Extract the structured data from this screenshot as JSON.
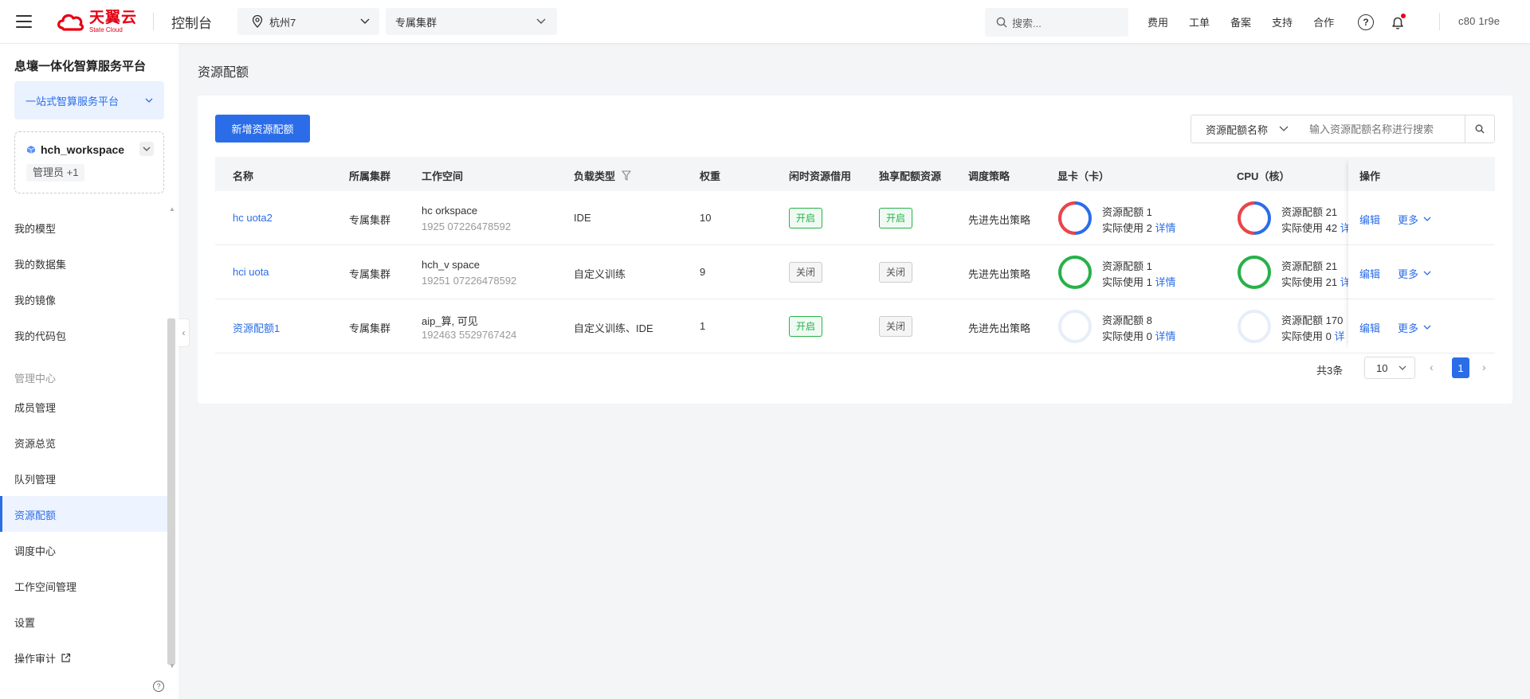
{
  "header": {
    "logo_cn": "天翼云",
    "logo_en": "State Cloud",
    "console_label": "控制台",
    "region": "杭州7",
    "cluster": "专属集群",
    "search_placeholder": "搜索...",
    "links": [
      "费用",
      "工单",
      "备案",
      "支持",
      "合作"
    ],
    "user_id": "c80   1r9e",
    "accent_color": "#e60012"
  },
  "sidebar": {
    "platform_title": "息壤一体化智算服务平台",
    "platform_select": "一站式智算服务平台",
    "workspace_name": "hch_workspace",
    "workspace_role": "管理员 +1",
    "items_top": [
      "我的模型",
      "我的数据集",
      "我的镜像",
      "我的代码包"
    ],
    "group_label": "管理中心",
    "items_mgmt": [
      "成员管理",
      "资源总览",
      "队列管理",
      "资源配额",
      "调度中心",
      "工作空间管理",
      "设置",
      "操作审计"
    ],
    "active_item": "资源配额"
  },
  "page": {
    "title": "资源配额",
    "add_button": "新增资源配额",
    "filter_select": "资源配额名称",
    "filter_placeholder": "输入资源配额名称进行搜索"
  },
  "table": {
    "columns": [
      "名称",
      "所属集群",
      "工作空间",
      "负载类型",
      "权重",
      "闲时资源借用",
      "独享配额资源",
      "调度策略",
      "显卡（卡）",
      "CPU（核）",
      "操作"
    ],
    "rows": [
      {
        "name": "hc      uota2",
        "cluster": "专属集群",
        "workspace_name": "hc      orkspace",
        "workspace_id": "1925      07226478592",
        "load_type": "IDE",
        "weight": "10",
        "idle_borrow": "开启",
        "idle_borrow_on": true,
        "exclusive": "开启",
        "exclusive_on": true,
        "strategy": "先进先出策略",
        "gpu_quota": "资源配额 1",
        "gpu_used": "实际使用 2",
        "gpu_usage_ratio": 2,
        "cpu_quota": "资源配额 21",
        "cpu_used": "实际使用 42",
        "cpu_usage_ratio": 2,
        "detail_label": "详情",
        "cpu_detail_label": "详",
        "edit_label": "编辑",
        "more_label": "更多"
      },
      {
        "name": "hci     uota",
        "cluster": "专属集群",
        "workspace_name": "hch_v     space",
        "workspace_id": "19251      07226478592",
        "load_type": "自定义训练",
        "weight": "9",
        "idle_borrow": "关闭",
        "idle_borrow_on": false,
        "exclusive": "关闭",
        "exclusive_on": false,
        "strategy": "先进先出策略",
        "gpu_quota": "资源配额 1",
        "gpu_used": "实际使用 1",
        "gpu_usage_ratio": 1,
        "cpu_quota": "资源配额 21",
        "cpu_used": "实际使用 21",
        "cpu_usage_ratio": 1,
        "detail_label": "详情",
        "cpu_detail_label": "详",
        "edit_label": "编辑",
        "more_label": "更多"
      },
      {
        "name": "资源配额1",
        "cluster": "专属集群",
        "workspace_name": "aip_算,      可见",
        "workspace_id": "192463      5529767424",
        "load_type": "自定义训练、IDE",
        "weight": "1",
        "idle_borrow": "开启",
        "idle_borrow_on": true,
        "exclusive": "关闭",
        "exclusive_on": false,
        "strategy": "先进先出策略",
        "gpu_quota": "资源配额 8",
        "gpu_used": "实际使用 0",
        "gpu_usage_ratio": 0,
        "cpu_quota": "资源配额 170",
        "cpu_used": "实际使用 0",
        "cpu_usage_ratio": 0,
        "detail_label": "详情",
        "cpu_detail_label": "详",
        "edit_label": "编辑",
        "more_label": "更多"
      }
    ]
  },
  "pagination": {
    "total": "共3条",
    "page_size": "10",
    "current_page": "1"
  },
  "colors": {
    "primary": "#2b6de8",
    "ring_full": "#27b148",
    "ring_over": "#ef4444",
    "ring_empty": "#e6eef9"
  }
}
